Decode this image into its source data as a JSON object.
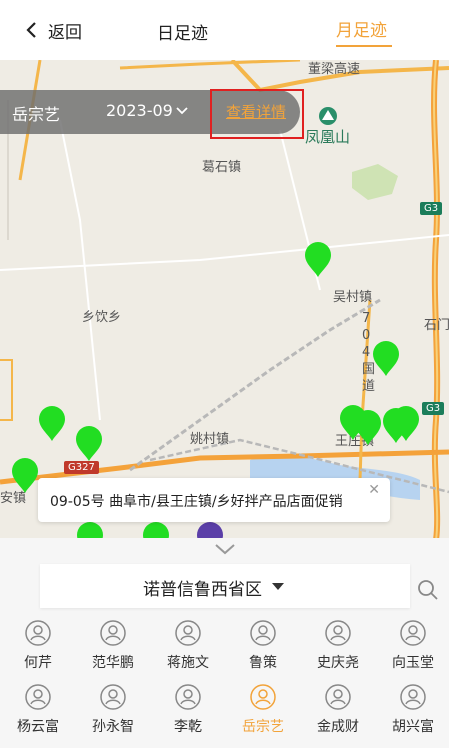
{
  "header": {
    "back_label": "返回",
    "tab_day": "日足迹",
    "tab_month": "月足迹"
  },
  "filter": {
    "person": "岳宗艺",
    "month": "2023-09",
    "detail_link": "查看详情"
  },
  "map": {
    "labels": [
      "董梁高速",
      "凤凰山",
      "葛石镇",
      "吴村镇",
      "乡饮乡",
      "姚村镇",
      "王庄镇",
      "石门",
      "安镇",
      "704国道"
    ],
    "highways": [
      "G3",
      "G3",
      "G327"
    ],
    "info_card": "09-05号  曲阜市/县王庄镇/乡好拌产品店面促销"
  },
  "region": {
    "label": "诺普信鲁西省区"
  },
  "people": [
    {
      "name": "何芹",
      "selected": false
    },
    {
      "name": "范华鹏",
      "selected": false
    },
    {
      "name": "蒋施文",
      "selected": false
    },
    {
      "name": "鲁策",
      "selected": false
    },
    {
      "name": "史庆尧",
      "selected": false
    },
    {
      "name": "向玉堂",
      "selected": false
    },
    {
      "name": "杨云富",
      "selected": false
    },
    {
      "name": "孙永智",
      "selected": false
    },
    {
      "name": "李乾",
      "selected": false
    },
    {
      "name": "岳宗艺",
      "selected": true
    },
    {
      "name": "金成财",
      "selected": false
    },
    {
      "name": "胡兴富",
      "selected": false
    }
  ],
  "colors": {
    "accent": "#f2a33a",
    "pin": "#22dd22",
    "highlight_box": "#e02020"
  }
}
